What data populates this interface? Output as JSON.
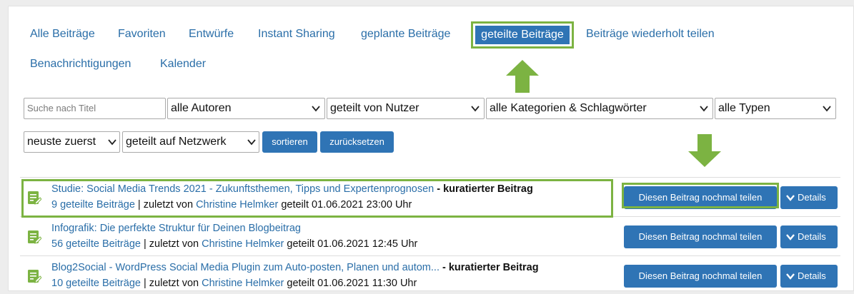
{
  "tabs": [
    {
      "label": "Alle Beiträge"
    },
    {
      "label": "Favoriten"
    },
    {
      "label": "Entwürfe"
    },
    {
      "label": "Instant Sharing"
    },
    {
      "label": "geplante Beiträge"
    },
    {
      "label": "geteilte Beiträge",
      "active": true
    },
    {
      "label": "Beiträge wiederholt teilen"
    },
    {
      "label": "Benachrichtigungen"
    },
    {
      "label": "Kalender"
    }
  ],
  "filters": {
    "search_placeholder": "Suche nach Titel",
    "authors": "alle Autoren",
    "shared_by": "geteilt von Nutzer",
    "categories": "alle Kategorien & Schlagwörter",
    "types": "alle Typen",
    "sort_order": "neuste zuerst",
    "network": "geteilt auf Netzwerk",
    "sort_button": "sortieren",
    "reset_button": "zurücksetzen"
  },
  "posts": [
    {
      "title": "Studie: Social Media Trends 2021 - Zukunftsthemen, Tipps und Expertenprognosen",
      "suffix": " - kuratierter Beitrag",
      "count": "9 geteilte Beiträge",
      "by_prefix": " | zuletzt von ",
      "author": "Christine Helmker",
      "shared": " geteilt 01.06.2021 23:00 Uhr"
    },
    {
      "title": "Infografik: Die perfekte Struktur für Deinen Blogbeitrag",
      "suffix": "",
      "count": "56 geteilte Beiträge",
      "by_prefix": " | zuletzt von ",
      "author": "Christine Helmker",
      "shared": " geteilt 01.06.2021 12:45 Uhr"
    },
    {
      "title": "Blog2Social - WordPress Social Media Plugin zum Auto-posten, Planen und autom...",
      "suffix": " - kuratierter Beitrag",
      "count": "10 geteilte Beiträge",
      "by_prefix": " | zuletzt von ",
      "author": "Christine Helmker",
      "shared": " geteilt 01.06.2021 11:30 Uhr"
    }
  ],
  "row_actions": {
    "share_again": "Diesen Beitrag nochmal teilen",
    "details": "Details"
  },
  "colors": {
    "accent": "#2f74b5",
    "highlight": "#7cb342",
    "link": "#2a6ea8"
  }
}
